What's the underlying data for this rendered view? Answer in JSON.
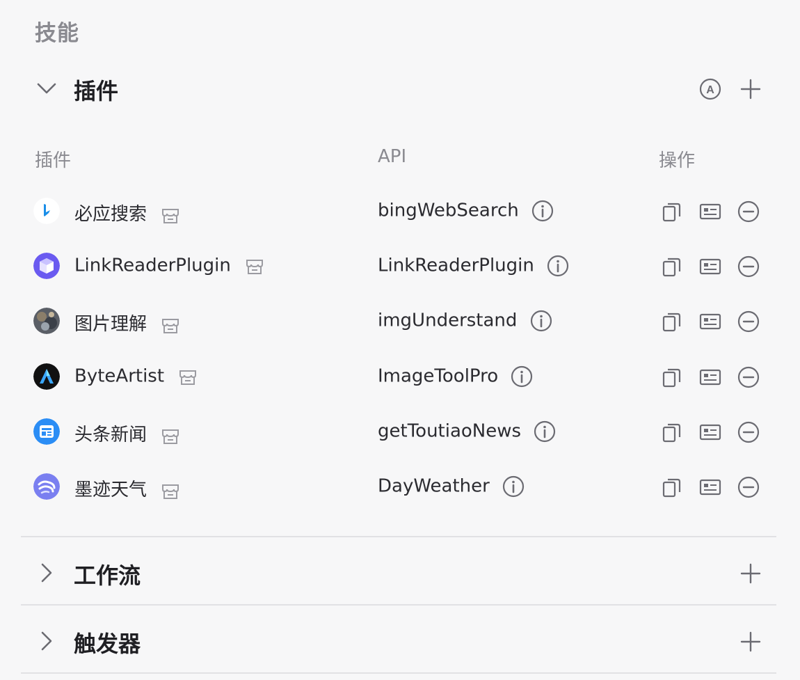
{
  "section_title": "技能",
  "plugins_group": {
    "title": "插件",
    "icons": {
      "collapse": "chevron-down-icon",
      "auto": "auto-icon",
      "add": "plus-icon"
    }
  },
  "columns": {
    "plugin": "插件",
    "api": "API",
    "actions": "操作"
  },
  "rows": [
    {
      "name": "必应搜索",
      "api": "bingWebSearch",
      "avatar": "bing-logo"
    },
    {
      "name": "LinkReaderPlugin",
      "api": "LinkReaderPlugin",
      "avatar": "cube-logo"
    },
    {
      "name": "图片理解",
      "api": "imgUnderstand",
      "avatar": "photo-thumbnail"
    },
    {
      "name": "ByteArtist",
      "api": "ImageToolPro",
      "avatar": "byteartist-logo"
    },
    {
      "name": "头条新闻",
      "api": "getToutiaoNews",
      "avatar": "toutiao-logo"
    },
    {
      "name": "墨迹天气",
      "api": "DayWeather",
      "avatar": "moji-weather-logo"
    }
  ],
  "workflow_group": {
    "title": "工作流"
  },
  "trigger_group": {
    "title": "触发器"
  },
  "colors": {
    "text_primary": "#1f1f23",
    "text_secondary": "#8a8a90",
    "icon": "#6b6b72",
    "divider": "#e1e1e4",
    "background": "#f7f7f8"
  }
}
